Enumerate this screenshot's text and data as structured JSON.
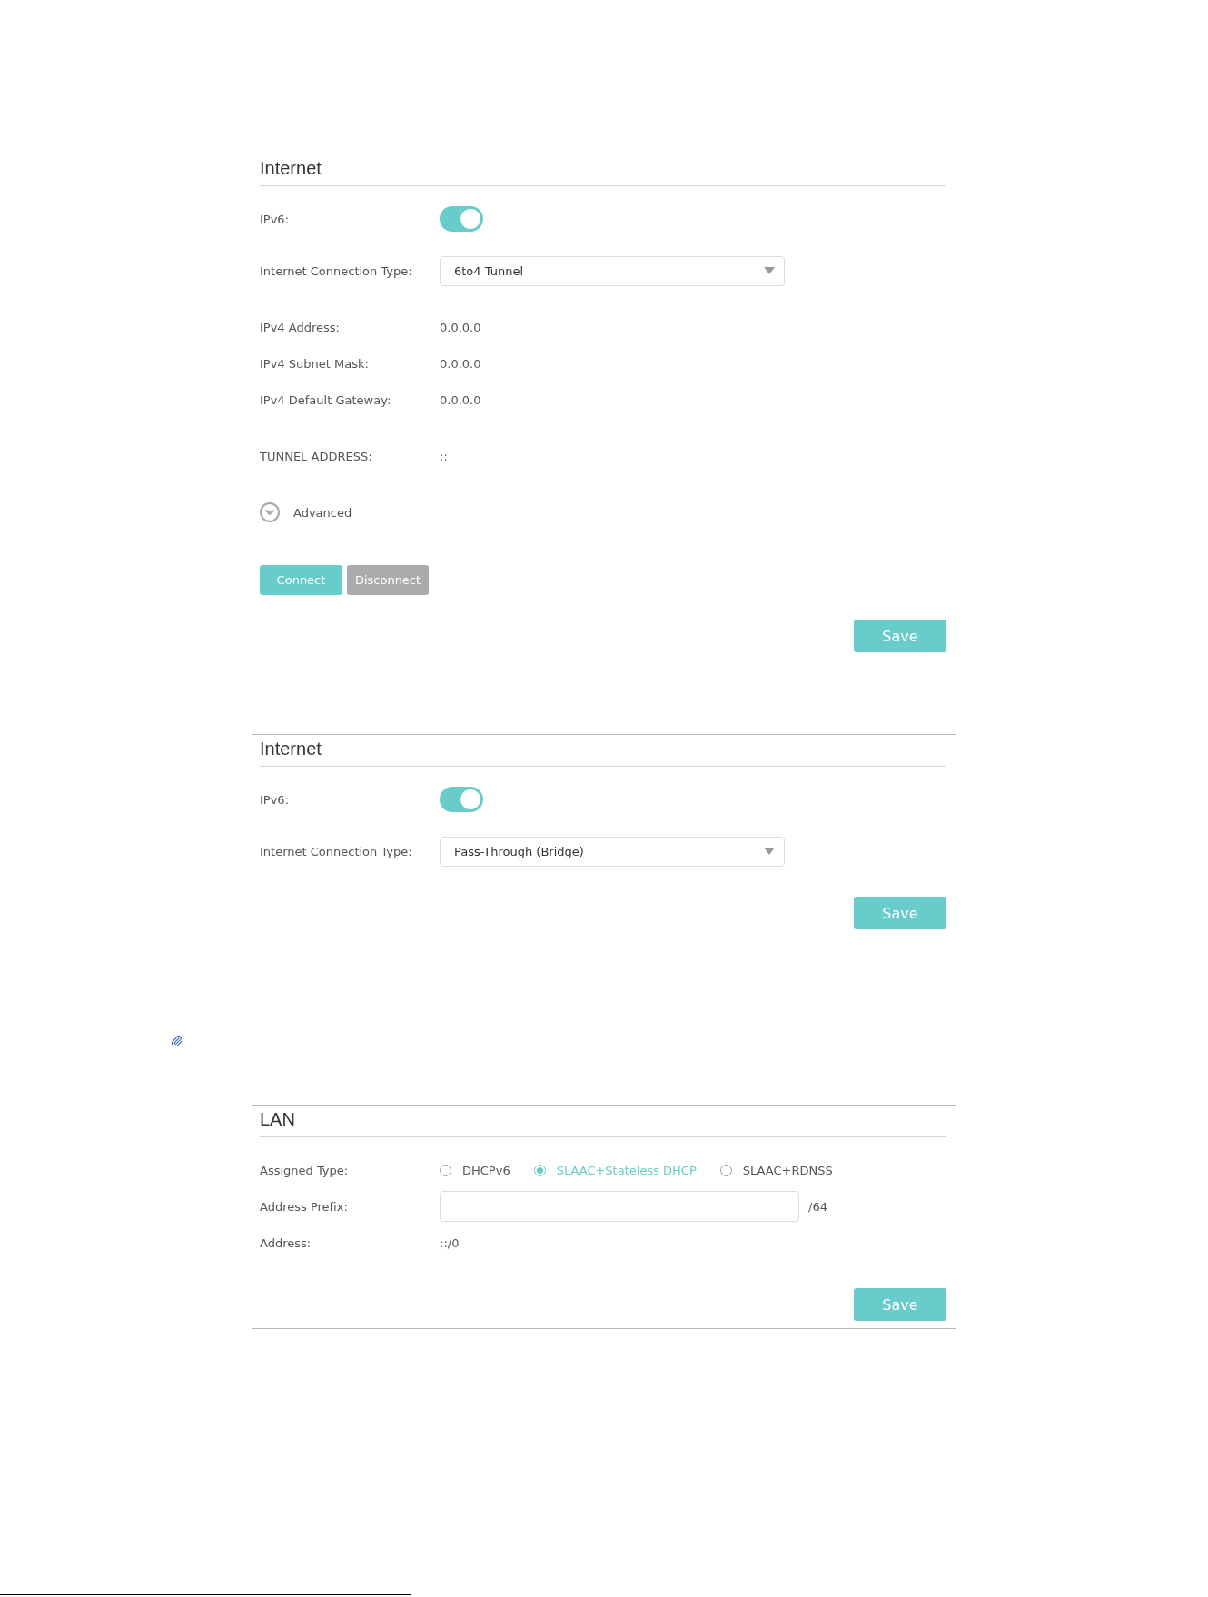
{
  "internet_panels": [
    {
      "title": "Internet",
      "sections": [
        [
          {
            "kind": "toggle",
            "label": "IPv6:",
            "on": true
          },
          {
            "kind": "select",
            "label": "Internet Connection Type:",
            "value": "6to4 Tunnel"
          }
        ],
        [
          {
            "kind": "text",
            "label": "IPv4 Address:",
            "value": "0.0.0.0"
          },
          {
            "kind": "text",
            "label": "IPv4 Subnet Mask:",
            "value": "0.0.0.0"
          },
          {
            "kind": "text",
            "label": "IPv4 Default Gateway:",
            "value": "0.0.0.0"
          }
        ],
        [
          {
            "kind": "text",
            "label": "TUNNEL ADDRESS:",
            "value": "::"
          }
        ],
        [
          {
            "kind": "expander",
            "label": "Advanced",
            "expanded": false
          }
        ]
      ],
      "actions": [
        {
          "label": "Connect",
          "disabled": false
        },
        {
          "label": "Disconnect",
          "disabled": true
        }
      ],
      "save": "Save"
    },
    {
      "title": "Internet",
      "sections": [
        [
          {
            "kind": "toggle",
            "label": "IPv6:",
            "on": true
          },
          {
            "kind": "select",
            "label": "Internet Connection Type:",
            "value": "Pass-Through (Bridge)"
          }
        ]
      ],
      "save": "Save"
    }
  ],
  "lan_panel": {
    "title": "LAN",
    "sections": [
      [
        {
          "kind": "radio",
          "label": "Assigned Type:",
          "options": [
            {
              "label": "DHCPv6",
              "selected": false
            },
            {
              "label": "SLAAC+Stateless DHCP",
              "selected": true
            },
            {
              "label": "SLAAC+RDNSS",
              "selected": false
            }
          ]
        },
        {
          "kind": "input",
          "label": "Address Prefix:",
          "suffix": "/64"
        },
        {
          "kind": "text",
          "label": "Address:",
          "value": "::/0"
        }
      ]
    ],
    "save": "Save"
  }
}
